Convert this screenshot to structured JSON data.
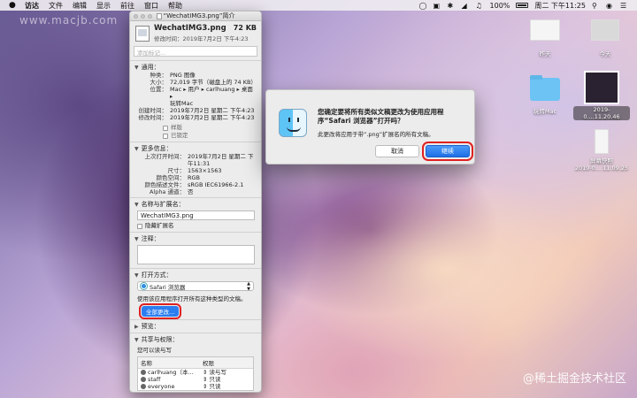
{
  "menubar": {
    "app": "访达",
    "items": [
      "文件",
      "编辑",
      "显示",
      "前往",
      "窗口",
      "帮助"
    ],
    "battery": "100%",
    "datetime": "周二 下午11:25"
  },
  "watermark": "www.macjb.com",
  "juejin": "@稀土掘金技术社区",
  "info": {
    "title": "“WechatIMG3.png”简介",
    "file_name": "WechatIMG3.png",
    "file_size": "72 KB",
    "modified_line": "修改时间：2019年7月2日 下午4:23",
    "tags_placeholder": "添加标记...",
    "general": {
      "header": "通用：",
      "rows": [
        {
          "k": "种类：",
          "v": "PNG 图像"
        },
        {
          "k": "大小：",
          "v": "72,019 字节（磁盘上的 74 KB）"
        },
        {
          "k": "位置：",
          "v": "Mac ▸ 用户 ▸ carlhuang ▸ 桌面 ▸"
        },
        {
          "k": "",
          "v": "玩转Mac"
        },
        {
          "k": "创建时间：",
          "v": "2019年7月2日 星期二 下午4:23"
        },
        {
          "k": "修改时间：",
          "v": "2019年7月2日 星期二 下午4:23"
        }
      ],
      "stationery": "样版",
      "locked": "已锁定"
    },
    "more": {
      "header": "更多信息：",
      "rows": [
        {
          "k": "上次打开时间：",
          "v": "2019年7月2日 星期二 下午11:31"
        },
        {
          "k": "尺寸：",
          "v": "1563×1563"
        },
        {
          "k": "颜色空间：",
          "v": "RGB"
        },
        {
          "k": "颜色描述文件：",
          "v": "sRGB IEC61966-2.1"
        },
        {
          "k": "Alpha 通道：",
          "v": "否"
        }
      ]
    },
    "name_ext": {
      "header": "名称与扩展名：",
      "value": "WechatIMG3.png",
      "hide_ext": "隐藏扩展名"
    },
    "comments": {
      "header": "注释："
    },
    "open_with": {
      "header": "打开方式：",
      "app": "Safari 浏览器",
      "hint": "使用该应用程序打开所有这种类型的文稿。",
      "change_all": "全部更改..."
    },
    "preview": {
      "header": "预览："
    },
    "sharing": {
      "header": "共享与权限：",
      "sub": "您可以读与写",
      "col_name": "名称",
      "col_priv": "权限",
      "rows": [
        {
          "name": "carlhuang（本...",
          "priv": "读与写"
        },
        {
          "name": "staff",
          "priv": "只读"
        },
        {
          "name": "everyone",
          "priv": "只读"
        }
      ]
    }
  },
  "dialog": {
    "title": "您确定要将所有类似文稿更改为使用应用程序“Safari 浏览器”打开吗？",
    "message": "此更改将应用于带“.png”扩展名的所有文稿。",
    "cancel": "取消",
    "continue": "继续"
  },
  "desktop": {
    "icons": [
      {
        "label": "昨天"
      },
      {
        "label": "今天"
      },
      {
        "label": "玩转Mac"
      },
      {
        "label": "2019-0....11.20.46"
      },
      {
        "label": "屏幕快照"
      },
      {
        "label": "2019-0....11.09.25"
      }
    ]
  }
}
